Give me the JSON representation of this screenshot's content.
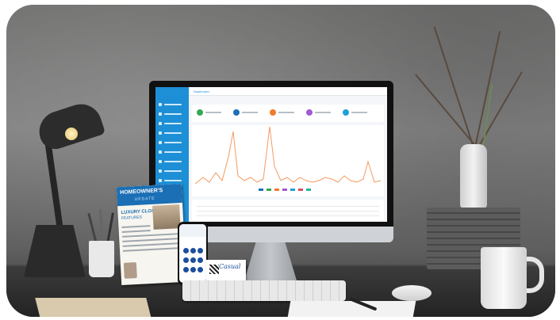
{
  "monitor": {
    "topbar_title": "Dashboard",
    "sidebar_count": 9,
    "stat_colors": [
      "#35a853",
      "#1d6fb5",
      "#f07b2c",
      "#a05ad6",
      "#1ea0dc"
    ],
    "chart_series_color": "#f39a62"
  },
  "postcard": {
    "title": "HOMEOWNER'S",
    "subtitle": "UPDATE",
    "heading": "LUXURY CLOSET",
    "heading2": "FEATURES"
  },
  "business_card": {
    "script_text": "Casual"
  },
  "colors": {
    "accent_blue": "#1d8fd6",
    "postcard_blue": "#1b6fb5"
  }
}
